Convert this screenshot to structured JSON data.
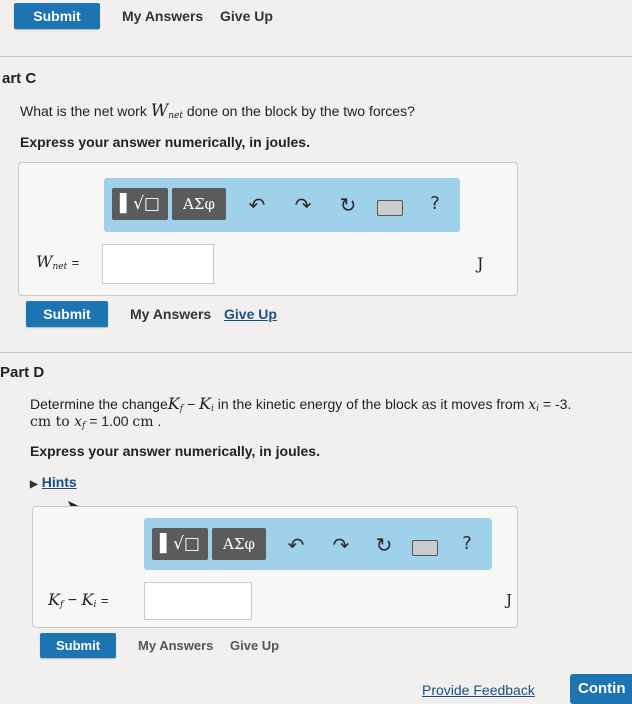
{
  "top": {
    "submit_label": "Submit",
    "my_answers_label": "My Answers",
    "give_up_label": "Give Up"
  },
  "part_c": {
    "heading": "art C",
    "question_prefix": "What is the net work ",
    "question_var": "W",
    "question_sub": "net",
    "question_suffix": " done on the block by the two forces?",
    "instruction": "Express your answer numerically, in joules.",
    "toolbar": {
      "templates": "▌√□",
      "greek": "ΑΣφ",
      "help": "?"
    },
    "var_label": "W",
    "var_sub": "net",
    "equals": "=",
    "input_value": "",
    "unit": "J",
    "submit_label": "Submit",
    "my_answers_label": "My Answers",
    "give_up_label": "Give Up"
  },
  "part_d": {
    "heading": "Part D",
    "question_line1_prefix": "Determine the change",
    "kf": "K",
    "kf_sub": "f",
    "minus": " − ",
    "ki": "K",
    "ki_sub": "i",
    "question_line1_mid": " in the kinetic energy of the block as it moves from ",
    "xi": "x",
    "xi_sub": "i",
    "xi_val": " = -3.",
    "question_line2_prefix": "cm to ",
    "xf": "x",
    "xf_sub": "f",
    "xf_val": " = 1.00 ",
    "xf_unit": "cm",
    "question_line2_end": " .",
    "instruction": "Express your answer numerically, in joules.",
    "hints_label": "Hints",
    "toolbar": {
      "templates": "▌√□",
      "greek": "ΑΣφ",
      "help": "?"
    },
    "equals": "=",
    "input_value": "",
    "unit": "J",
    "submit_label": "Submit",
    "my_answers_label": "My Answers",
    "give_up_label": "Give Up"
  },
  "footer": {
    "feedback_label": "Provide Feedback",
    "continue_label": "Contin"
  },
  "colors": {
    "accent": "#1c74b3",
    "toolbar": "#9fd1ea",
    "link": "#1a4f86"
  }
}
